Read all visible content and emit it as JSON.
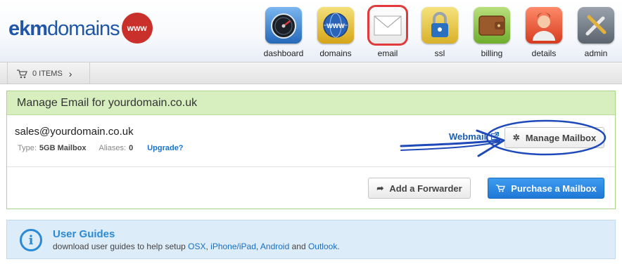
{
  "logo": {
    "part1": "ekm",
    "part2": "domains",
    "badge": "www"
  },
  "nav": [
    {
      "label": "dashboard",
      "icon": "speedometer-icon"
    },
    {
      "label": "domains",
      "icon": "globe-icon"
    },
    {
      "label": "email",
      "icon": "envelope-icon",
      "active": true
    },
    {
      "label": "ssl",
      "icon": "padlock-icon"
    },
    {
      "label": "billing",
      "icon": "wallet-icon"
    },
    {
      "label": "details",
      "icon": "user-icon"
    },
    {
      "label": "admin",
      "icon": "wrench-screwdriver-icon"
    }
  ],
  "cart": {
    "label": "0 ITEMS"
  },
  "panel": {
    "title": "Manage Email for yourdomain.co.uk",
    "mailbox": {
      "address": "sales@yourdomain.co.uk",
      "type_label": "Type:",
      "type_value": "5GB Mailbox",
      "aliases_label": "Aliases:",
      "aliases_value": "0",
      "upgrade": "Upgrade?",
      "webmail": "Webmail",
      "manage": "Manage Mailbox"
    },
    "actions": {
      "forwarder": "Add a Forwarder",
      "purchase": "Purchase a Mailbox"
    }
  },
  "guides": {
    "title": "User Guides",
    "text_prefix": "download user guides to help setup ",
    "links": [
      "OSX",
      "iPhone/iPad",
      "Android",
      "Outlook"
    ],
    "sep1": ", ",
    "sep2": ", ",
    "sep3": " and ",
    "suffix": "."
  },
  "colors": {
    "brand": "#1f56a8",
    "accent": "#2b8ad6",
    "primary_button": "#1f78d6",
    "panel_head": "#d7efbf"
  }
}
